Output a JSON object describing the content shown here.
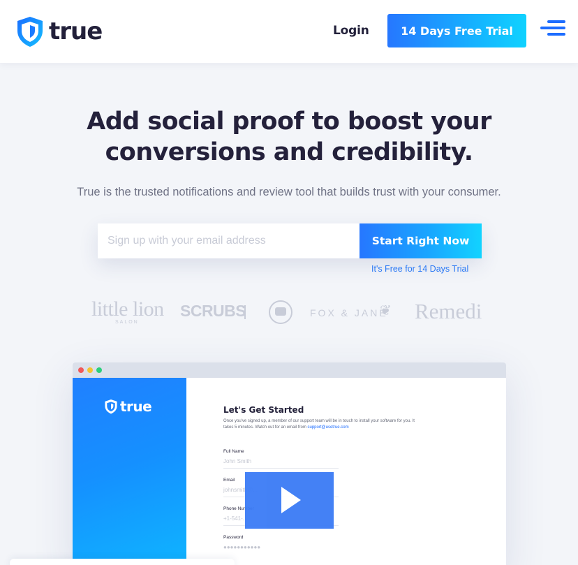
{
  "header": {
    "logo_text": "true",
    "login_label": "Login",
    "trial_button_label": "14 Days Free Trial",
    "accent_color": "#1d6dff"
  },
  "hero": {
    "title_line1": "Add social proof to boost your",
    "title_line2": "conversions and credibility.",
    "subtitle": "True is the trusted notifications and review tool that builds trust with your consumer."
  },
  "signup": {
    "email_placeholder": "Sign up with your email address",
    "email_value": "",
    "button_label": "Start Right Now",
    "note": "It's Free for 14 Days Trial"
  },
  "clients": {
    "lion": "little lion",
    "lion_sub": "SALON",
    "scrubs": "SCRUBS",
    "fox": "FOX & JANE",
    "remedi": "Remedi"
  },
  "preview": {
    "side_logo_text": "true",
    "title": "Let's Get Started",
    "desc_text": "Once you've signed up, a member of our support team will be in touch to install your software for you. It takes 5 minutes. Watch out for an email from",
    "desc_link": "support@usetrue.com",
    "fields": {
      "full_name_label": "Full Name",
      "full_name_value": "John Smith",
      "email_label": "Email",
      "email_value": "johnsmith@...",
      "phone_label": "Phone Number",
      "phone_value": "+1-541-...",
      "password_label": "Password",
      "password_value": "●●●●●●●●●●●"
    }
  }
}
